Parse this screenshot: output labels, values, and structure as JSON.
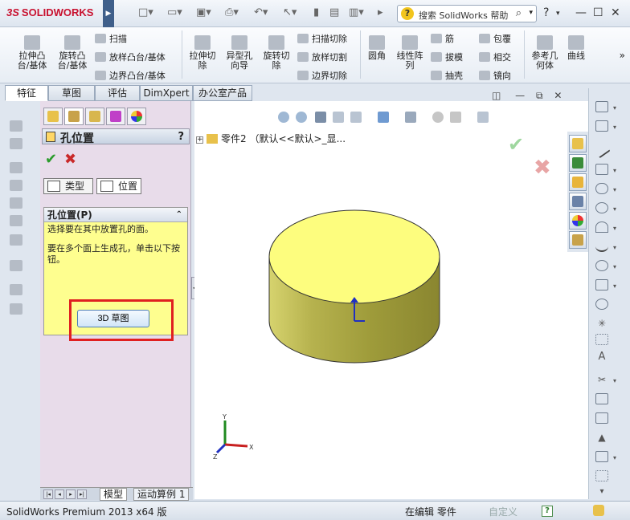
{
  "app": {
    "logo_prefix": "3S",
    "logo_text": "SOLIDWORKS",
    "search_placeholder": "搜索 SolidWorks 帮助",
    "help_label": "?",
    "window_minimize": "—",
    "window_restore": "☐",
    "window_close": "✕"
  },
  "ribbon": {
    "items_large": [
      {
        "label": "拉伸凸\n台/基体"
      },
      {
        "label": "旋转凸\n台/基体"
      },
      {
        "label": "拉伸切\n除"
      },
      {
        "label": "异型孔\n向导"
      },
      {
        "label": "旋转切\n除"
      },
      {
        "label": "圆角"
      },
      {
        "label": "线性阵\n列"
      },
      {
        "label": "参考几\n何体"
      },
      {
        "label": "曲线"
      }
    ],
    "items_small": [
      {
        "label": "扫描"
      },
      {
        "label": "放样凸台/基体"
      },
      {
        "label": "边界凸台/基体"
      },
      {
        "label": "扫描切除"
      },
      {
        "label": "放样切割"
      },
      {
        "label": "边界切除"
      },
      {
        "label": "筋"
      },
      {
        "label": "拔模"
      },
      {
        "label": "抽壳"
      },
      {
        "label": "包覆"
      },
      {
        "label": "相交"
      },
      {
        "label": "镜向"
      }
    ]
  },
  "tabs": [
    {
      "label": "特征"
    },
    {
      "label": "草图"
    },
    {
      "label": "评估"
    },
    {
      "label": "DimXpert"
    },
    {
      "label": "办公室产品"
    }
  ],
  "property_manager": {
    "title": "孔位置",
    "help": "?",
    "ok": "✔",
    "cancel": "✖",
    "subtabs": [
      {
        "label": "类型"
      },
      {
        "label": "位置"
      }
    ],
    "section_title": "孔位置(P)",
    "section_collapse": "⌃",
    "instruction_1": "选择要在其中放置孔的面。",
    "instruction_2": "要在多个面上生成孔，单击以下按钮。",
    "sketch3d_button": "3D 草图"
  },
  "feature_tree": {
    "expand": "+",
    "part_label": "零件2 （默认<<默认>_显..."
  },
  "graphics": {
    "confirm_ok": "✔",
    "confirm_cancel": "✖",
    "triad": {
      "x": "X",
      "y": "Y",
      "z": "Z"
    }
  },
  "bottom_tabs": [
    {
      "label": "模型"
    },
    {
      "label": "运动算例 1"
    }
  ],
  "status": {
    "app_version": "SolidWorks Premium 2013 x64 版",
    "mode": "在编辑 零件",
    "custom": "自定义",
    "help_glyph": "?"
  },
  "colors": {
    "cylinder_top": "#fdfd7e",
    "cylinder_side": "#9e9b3a",
    "highlight_red": "#e02020",
    "section_bg": "#fefe8f"
  }
}
